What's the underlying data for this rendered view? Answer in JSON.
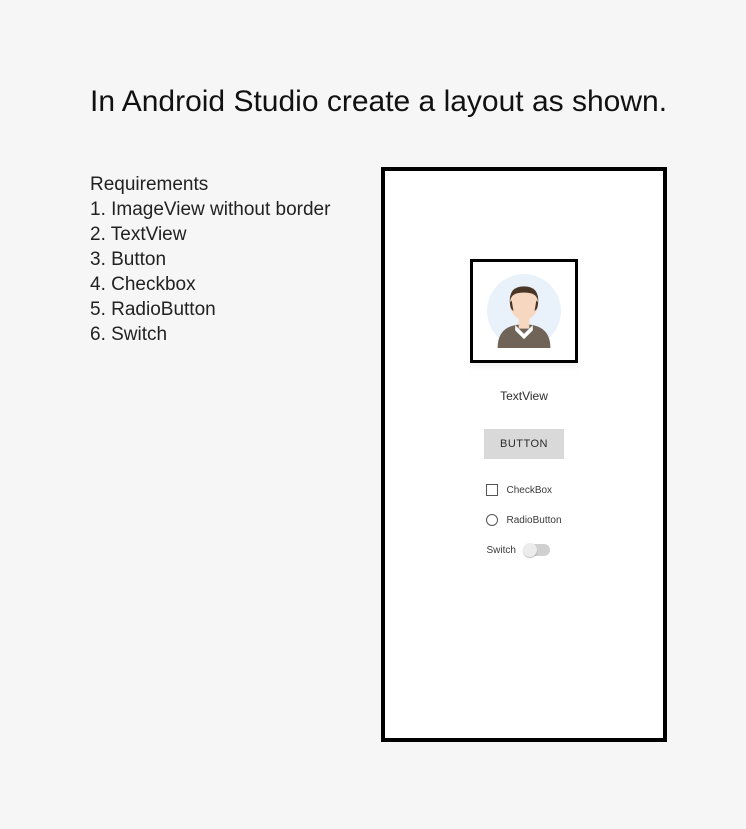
{
  "title": "In Android Studio create a layout as shown.",
  "requirements": {
    "heading": "Requirements",
    "items": [
      "1. ImageView without border",
      "2. TextView",
      "3. Button",
      "4. Checkbox",
      "5. RadioButton",
      "6. Switch"
    ]
  },
  "phone": {
    "text_view_label": "TextView",
    "button_label": "BUTTON",
    "checkbox_label": "CheckBox",
    "radio_label": "RadioButton",
    "switch_label": "Switch"
  }
}
